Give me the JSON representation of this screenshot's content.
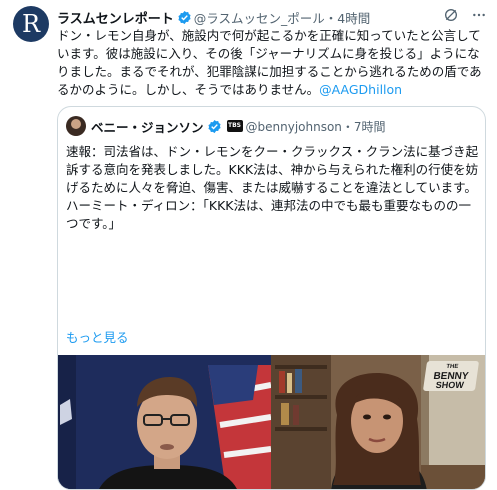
{
  "post": {
    "avatar_letter": "R",
    "display_name": "ラスムセンレポート",
    "handle_time": "@ラスムッセン_ポール・4時間",
    "text": "ドン・レモン自身が、施設内で何が起こるかを正確に知っていたと公言しています。彼は施設に入り、その後「ジャーナリズムに身を投じる」ようになりました。まるでそれが、犯罪陰謀に加担することから逃れるための盾であるかのように。しかし、そうではありません。",
    "mention": "@AAGDhillon"
  },
  "quote": {
    "display_name": "ベニー・ジョンソン",
    "badge_text": "TBS",
    "handle_time": "@bennyjohnson・7時間",
    "text": "速報：司法省は、ドン・レモンをクー・クラックス・クラン法に基づき起訴する意向を発表しました。KKK法は、神から与えられた権利の行使を妨げるために人々を脅迫、傷害、または威嚇することを違法としています。ハーミート・ディロン：「KKK法は、連邦法の中でも最も重要なものの一つです。」",
    "show_more": "もっと見る",
    "video_logo_line1": "THE",
    "video_logo_line2": "BENNY",
    "video_logo_line3": "SHOW"
  },
  "colors": {
    "link": "#1d9bf0",
    "verified": "#1d9bf0",
    "muted": "#536471",
    "border": "#cfd9de"
  },
  "icons": [
    "verified-badge-icon",
    "grok-icon",
    "more-icon",
    "tv-badge-icon"
  ]
}
